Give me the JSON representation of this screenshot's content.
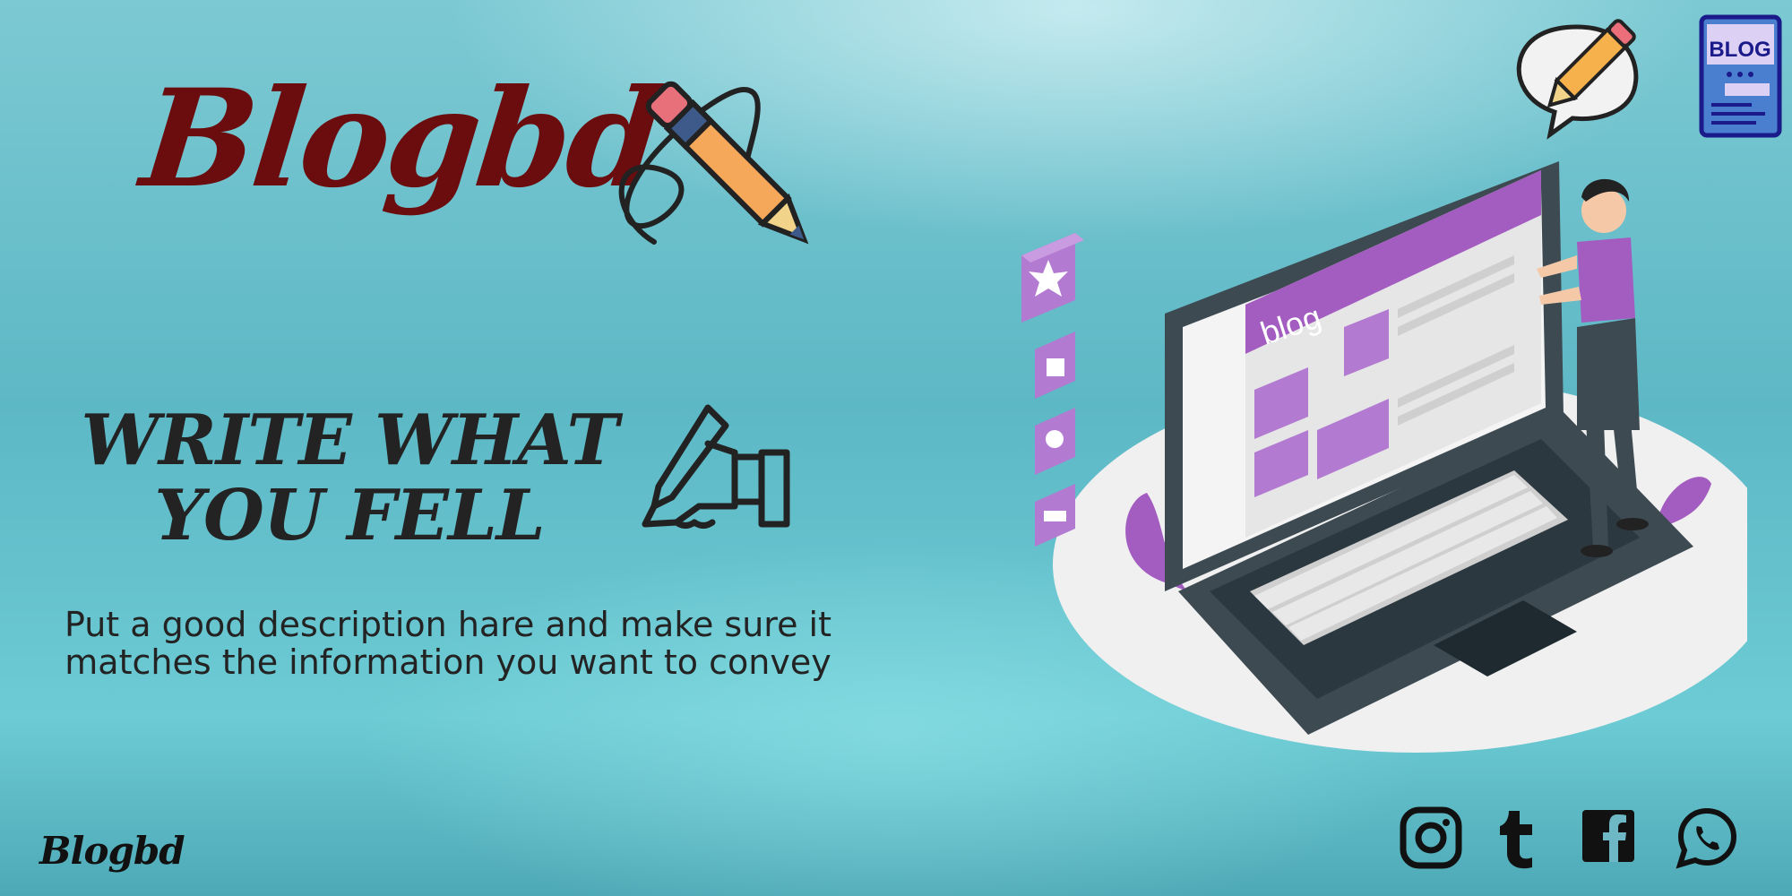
{
  "brand": {
    "title": "Blogbd",
    "footer_logo": "Blogbd"
  },
  "headline": {
    "line1": "WRITE WHAT",
    "line2": "YOU FELL"
  },
  "description": {
    "line1": "Put a good description hare and make sure it",
    "line2": "matches the information you want to convey"
  },
  "illustration": {
    "screen_label": "blog",
    "reaction_icons": [
      "star-icon",
      "thumbs-up-icon",
      "heart-icon",
      "message-icon"
    ]
  },
  "top_icons": {
    "chat_pencil": "pencil-chat-icon",
    "blog_card_label": "BLOG"
  },
  "social": [
    "instagram-icon",
    "tumblr-icon",
    "facebook-icon",
    "whatsapp-icon"
  ],
  "colors": {
    "brand_red": "#6b0d0f",
    "accent_purple": "#a35cc0",
    "laptop_dark": "#3d4a52",
    "text_dark": "#232323"
  }
}
